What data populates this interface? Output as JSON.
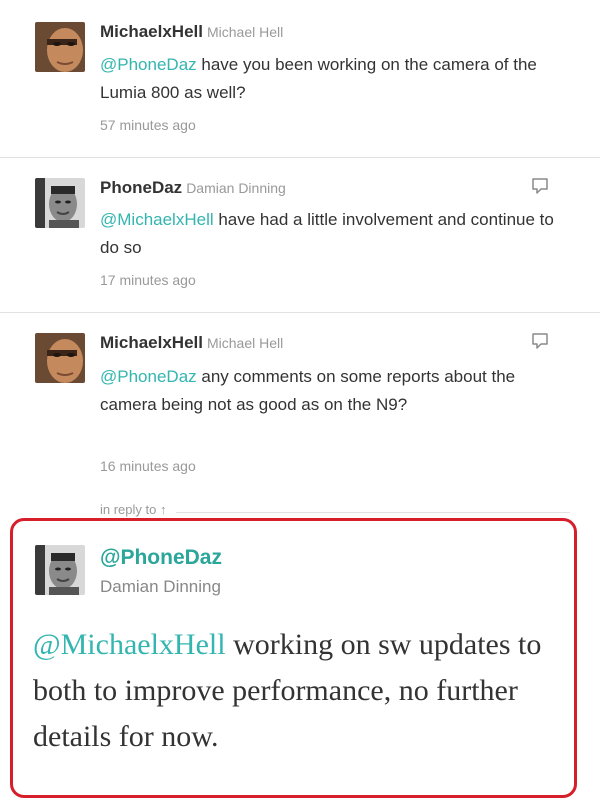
{
  "tweets": [
    {
      "screen_name": "MichaelxHell",
      "full_name": "Michael Hell",
      "mention": "@PhoneDaz",
      "text": " have you been working on the camera of the Lumia 800 as well?",
      "time": "57 minutes ago"
    },
    {
      "screen_name": "PhoneDaz",
      "full_name": "Damian Dinning",
      "mention": "@MichaelxHell",
      "text": " have had a little involvement and continue to do so",
      "time": "17 minutes ago"
    },
    {
      "screen_name": "MichaelxHell",
      "full_name": "Michael Hell",
      "mention": "@PhoneDaz",
      "text": " any comments on some reports about the camera being not as good as on the N9?",
      "time": "16 minutes ago"
    }
  ],
  "in_reply_to": "in reply to ↑",
  "featured": {
    "screen_name": "@PhoneDaz",
    "full_name": "Damian Dinning",
    "mention": "@MichaelxHell",
    "text": " working on sw updates to both to improve performance, no further details for now."
  },
  "icons": {
    "reply": "reply-bubble-icon"
  },
  "colors": {
    "mention": "#33b5b0",
    "highlight_border": "#d61f2b",
    "meta_text": "#999999"
  }
}
